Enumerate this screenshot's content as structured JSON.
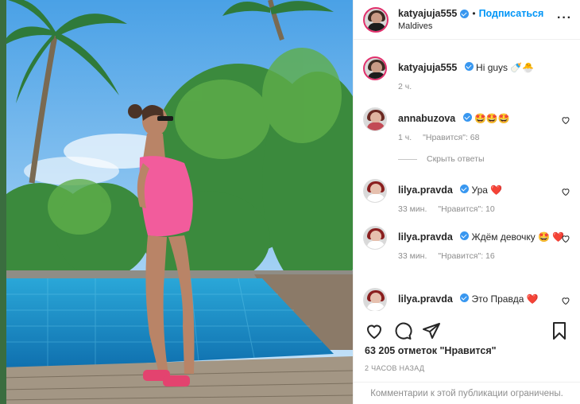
{
  "post": {
    "username": "katyajuja555",
    "follow_label": "Подписаться",
    "location": "Maldives",
    "more_icon": "more-horizontal-icon"
  },
  "caption": {
    "username": "katyajuja555",
    "text": "Hi guys 🍼🐣",
    "time": "2 ч."
  },
  "comments": [
    {
      "username": "annabuzova",
      "text": "🤩🤩🤩",
      "time": "1 ч.",
      "likes": "\"Нравится\": 68"
    },
    {
      "username": "lilya.pravda",
      "text": "Ура ❤️",
      "time": "33 мин.",
      "likes": "\"Нравится\": 10"
    },
    {
      "username": "lilya.pravda",
      "text": "Ждём девочку 🤩 ❤️",
      "time": "33 мин.",
      "likes": "\"Нравится\": 16"
    },
    {
      "username": "lilya.pravda",
      "text": "Это Правда ❤️",
      "time": "",
      "likes": ""
    }
  ],
  "hide_replies_label": "Скрыть ответы",
  "likes_text": "63 205 отметок \"Нравится\"",
  "time_ago": "2 ЧАСОВ НАЗАД",
  "footer_text": "Комментарии к этой публикации ограничены.",
  "colors": {
    "accent": "#0095f6",
    "verified": "#3897f0",
    "heart": "#ed4956",
    "muted": "#8e8e8e"
  },
  "icons": {
    "like": "heart-icon",
    "comment": "comment-icon",
    "share": "paper-plane-icon",
    "save": "bookmark-icon"
  }
}
